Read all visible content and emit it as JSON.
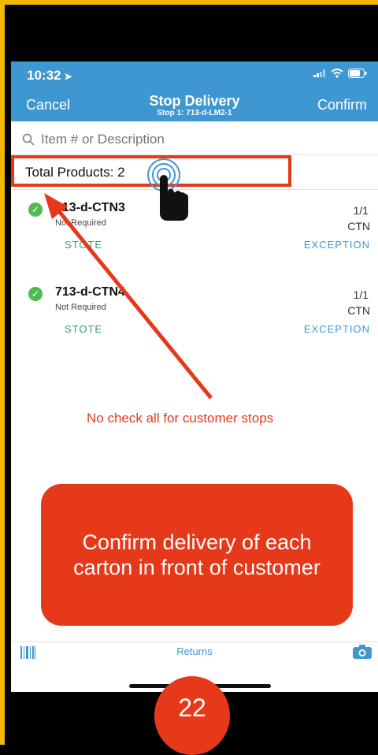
{
  "status_bar": {
    "time": "10:32",
    "location_arrow": "➤"
  },
  "nav": {
    "cancel_label": "Cancel",
    "title": "Stop Delivery",
    "subtitle": "Stop 1: 713-d-LM2-1",
    "confirm_label": "Confirm"
  },
  "search": {
    "placeholder": "Item # or Description"
  },
  "total_products": "Total Products: 2",
  "items": [
    {
      "id": "713-d-CTN3",
      "sub": "Not Required",
      "qty": "1/1",
      "unit": "CTN",
      "stote": "STOTE",
      "exception": "EXCEPTION"
    },
    {
      "id": "713-d-CTN4",
      "sub": "Not Required",
      "qty": "1/1",
      "unit": "CTN",
      "stote": "STOTE",
      "exception": "EXCEPTION"
    }
  ],
  "annotation_note": "No check all for customer stops",
  "banner_text": "Confirm delivery of each carton in front of customer",
  "bottom_bar": {
    "returns_label": "Returns"
  },
  "page_number": "22",
  "colors": {
    "accent": "#3f97d2",
    "annotation": "#e5391a",
    "frame": "#f2b705",
    "check": "#4ebc52"
  },
  "icons": [
    "location-arrow-icon",
    "signal-icon",
    "wifi-icon",
    "battery-icon",
    "search-icon",
    "check-icon",
    "hand-cursor-icon",
    "barcode-icon",
    "camera-icon"
  ]
}
